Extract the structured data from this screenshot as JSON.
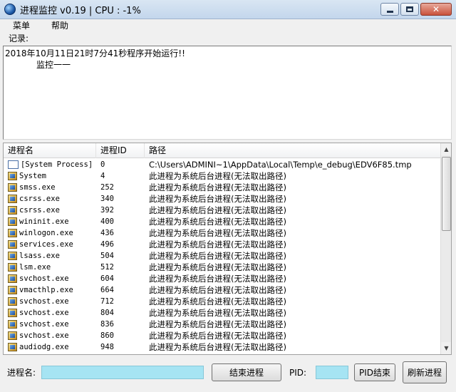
{
  "window": {
    "title": "进程监控 v0.19 |  CPU : -1%"
  },
  "menu": [
    "菜单",
    "帮助"
  ],
  "record_label": "记录:",
  "log": [
    "2018年10月11日21时7分41秒程序开始运行!!",
    "监控一一"
  ],
  "table": {
    "columns": [
      "进程名",
      "进程ID",
      "路径"
    ],
    "rows": [
      {
        "name": "[System Process]",
        "pid": "0",
        "path": "C:\\Users\\ADMINI~1\\AppData\\Local\\Temp\\e_debug\\EDV6F85.tmp",
        "icon": "window-icon"
      },
      {
        "name": "System",
        "pid": "4",
        "path": "此进程为系统后台进程(无法取出路径)",
        "icon": "exe-icon"
      },
      {
        "name": "smss.exe",
        "pid": "252",
        "path": "此进程为系统后台进程(无法取出路径)",
        "icon": "exe-icon"
      },
      {
        "name": "csrss.exe",
        "pid": "340",
        "path": "此进程为系统后台进程(无法取出路径)",
        "icon": "exe-icon"
      },
      {
        "name": "csrss.exe",
        "pid": "392",
        "path": "此进程为系统后台进程(无法取出路径)",
        "icon": "exe-icon"
      },
      {
        "name": "wininit.exe",
        "pid": "400",
        "path": "此进程为系统后台进程(无法取出路径)",
        "icon": "exe-icon"
      },
      {
        "name": "winlogon.exe",
        "pid": "436",
        "path": "此进程为系统后台进程(无法取出路径)",
        "icon": "exe-icon"
      },
      {
        "name": "services.exe",
        "pid": "496",
        "path": "此进程为系统后台进程(无法取出路径)",
        "icon": "exe-icon"
      },
      {
        "name": "lsass.exe",
        "pid": "504",
        "path": "此进程为系统后台进程(无法取出路径)",
        "icon": "exe-icon"
      },
      {
        "name": "lsm.exe",
        "pid": "512",
        "path": "此进程为系统后台进程(无法取出路径)",
        "icon": "exe-icon"
      },
      {
        "name": "svchost.exe",
        "pid": "604",
        "path": "此进程为系统后台进程(无法取出路径)",
        "icon": "exe-icon"
      },
      {
        "name": "vmacthlp.exe",
        "pid": "664",
        "path": "此进程为系统后台进程(无法取出路径)",
        "icon": "exe-icon"
      },
      {
        "name": "svchost.exe",
        "pid": "712",
        "path": "此进程为系统后台进程(无法取出路径)",
        "icon": "exe-icon"
      },
      {
        "name": "svchost.exe",
        "pid": "804",
        "path": "此进程为系统后台进程(无法取出路径)",
        "icon": "exe-icon"
      },
      {
        "name": "svchost.exe",
        "pid": "836",
        "path": "此进程为系统后台进程(无法取出路径)",
        "icon": "exe-icon"
      },
      {
        "name": "svchost.exe",
        "pid": "860",
        "path": "此进程为系统后台进程(无法取出路径)",
        "icon": "exe-icon"
      },
      {
        "name": "audiodg.exe",
        "pid": "948",
        "path": "此进程为系统后台进程(无法取出路径)",
        "icon": "exe-icon"
      }
    ]
  },
  "bottom": {
    "process_name_label": "进程名:",
    "process_name_value": "",
    "end_button": "结束进程",
    "pid_label": "PID:",
    "pid_value": "",
    "pid_end_button": "PID结束",
    "refresh_button": "刷新进程"
  },
  "colors": {
    "input_bg": "#a6e4f3"
  }
}
